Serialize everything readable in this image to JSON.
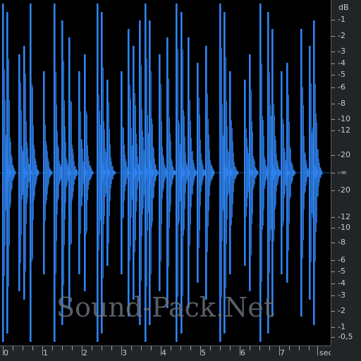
{
  "editor": {
    "waveform_color": "#2f84f2",
    "background_color": "#000000",
    "ruler_background_color": "#222528",
    "watermark_text": "Sound-Pack.Net"
  },
  "db_ruler": {
    "unit": "dB",
    "upper_ticks": [
      "-1",
      "-2",
      "-3",
      "-4",
      "-5",
      "-6",
      "-8",
      "-10",
      "-12",
      "-20"
    ],
    "center_tick": "-∞",
    "lower_ticks": [
      "-20",
      "-12",
      "-10",
      "-8",
      "-6",
      "-5",
      "-4",
      "-3",
      "-2",
      "-1",
      "-0,5"
    ]
  },
  "time_ruler": {
    "unit": "sec",
    "labels": [
      "0",
      "1",
      "2",
      "3",
      "4",
      "5",
      "6",
      "7"
    ]
  }
}
